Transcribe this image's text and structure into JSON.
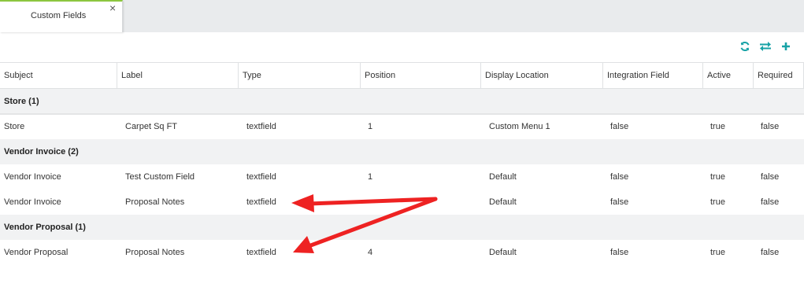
{
  "tabs": [
    {
      "label": "Custom Fields",
      "close": "×"
    }
  ],
  "toolbar": {
    "refresh_icon": "refresh-icon",
    "swap_icon": "swap-icon",
    "add_icon": "add-icon",
    "accent": "#17a2a6"
  },
  "table": {
    "columns": [
      "Subject",
      "Label",
      "Type",
      "Position",
      "Display Location",
      "Integration Field",
      "Active",
      "Required"
    ],
    "groups": [
      {
        "title": "Store (1)",
        "rows": [
          [
            "Store",
            "Carpet Sq FT",
            "textfield",
            "1",
            "Custom Menu 1",
            "false",
            "true",
            "false"
          ]
        ]
      },
      {
        "title": "Vendor Invoice (2)",
        "rows": [
          [
            "Vendor Invoice",
            "Test Custom Field",
            "textfield",
            "1",
            "Default",
            "false",
            "true",
            "false"
          ],
          [
            "Vendor Invoice",
            "Proposal Notes",
            "textfield",
            "",
            "Default",
            "false",
            "true",
            "false"
          ]
        ]
      },
      {
        "title": "Vendor Proposal (1)",
        "rows": [
          [
            "Vendor Proposal",
            "Proposal Notes",
            "textfield",
            "4",
            "Default",
            "false",
            "true",
            "false"
          ]
        ]
      }
    ]
  },
  "annotation_color": "#ee2222"
}
